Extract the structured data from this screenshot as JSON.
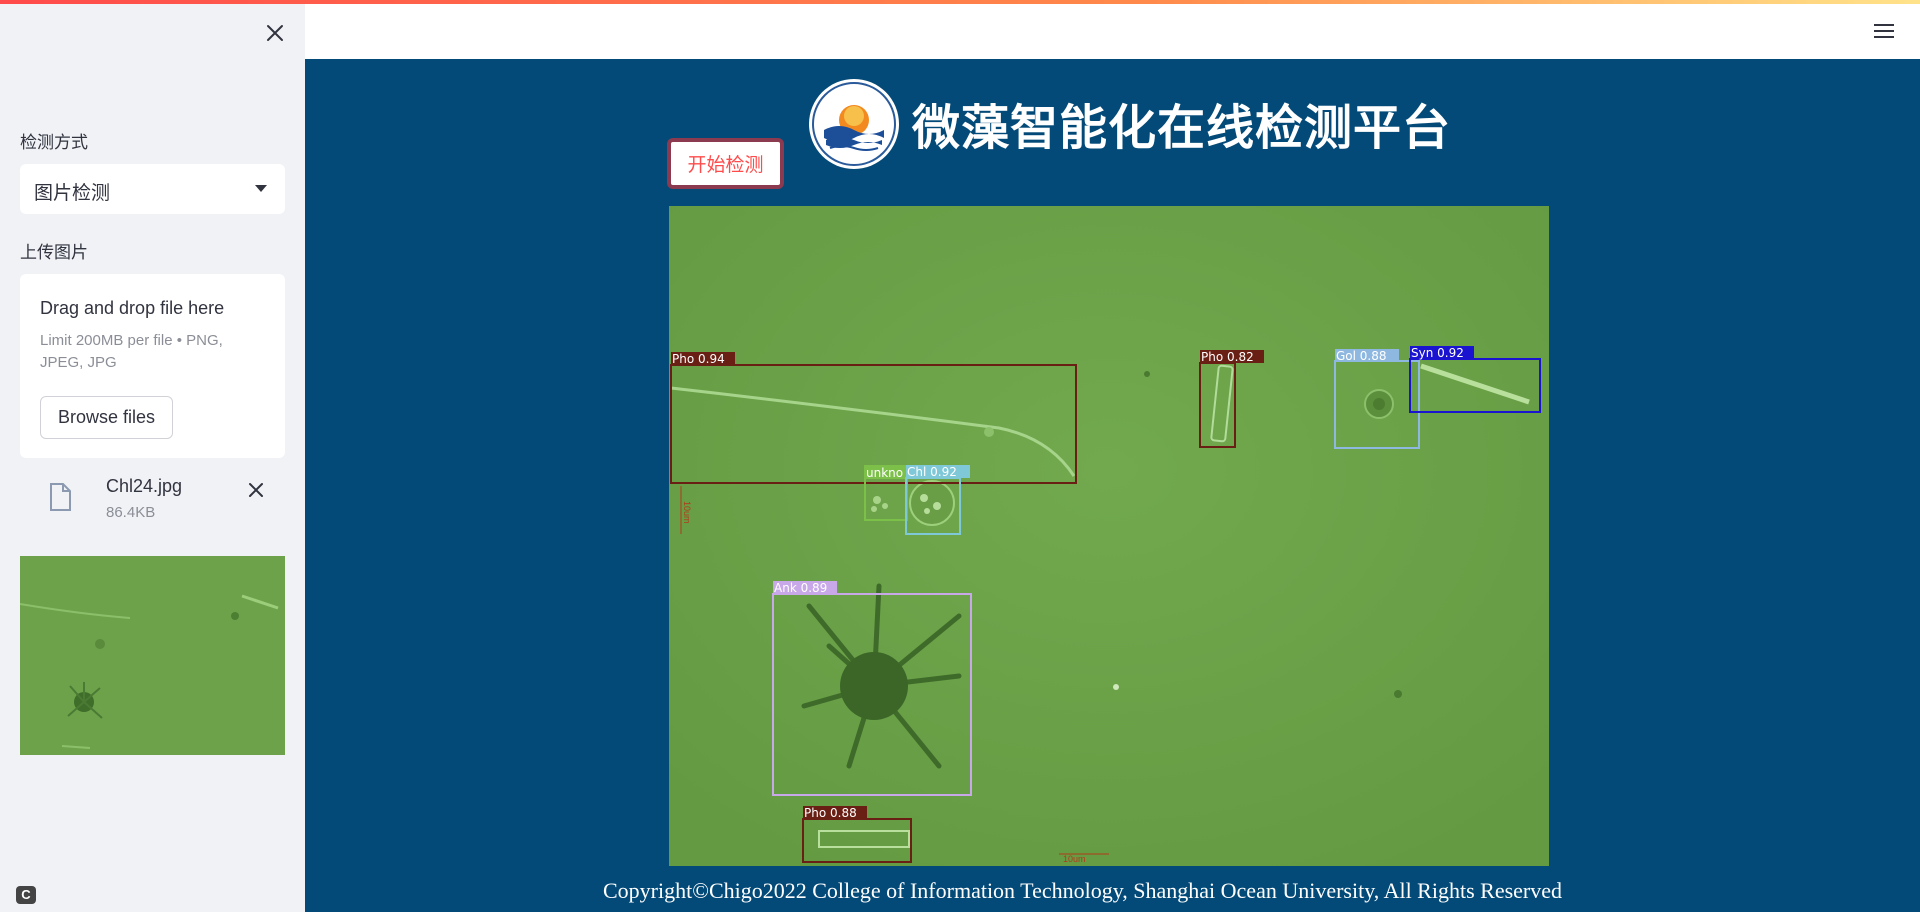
{
  "sidebar": {
    "detect_mode_label": "检测方式",
    "detect_mode_value": "图片检测",
    "upload_label": "上传图片",
    "dropzone_title": "Drag and drop file here",
    "dropzone_limit": "Limit 200MB per file • PNG, JPEG, JPG",
    "browse_label": "Browse files",
    "file_name": "Chl24.jpg",
    "file_size": "86.4KB"
  },
  "main": {
    "title": "微藻智能化在线检测平台",
    "start_button": "开始检测",
    "footer": "Copyright©Chigo2022 College of Information Technology, Shanghai Ocean University, All Rights Reserved"
  },
  "detections": [
    {
      "label": "Pho 0.94",
      "color": "#6a1f14"
    },
    {
      "label": "Pho 0.82",
      "color": "#6a1f14"
    },
    {
      "label": "Gol 0.88",
      "color": "#8fb8e0"
    },
    {
      "label": "Syn 0.92",
      "color": "#1a14d0"
    },
    {
      "label": "unkno",
      "color": "#7cc04a"
    },
    {
      "label": "Chl 0.92",
      "color": "#7fc8d8"
    },
    {
      "label": "Ank 0.89",
      "color": "#c8a8e8"
    },
    {
      "label": "Pho 0.88",
      "color": "#6a1f14"
    }
  ],
  "scale_bars": [
    "10um",
    "10um"
  ],
  "colors": {
    "sidebar_bg": "#f0f2f6",
    "main_bg": "#044a78",
    "accent": "#ff4b4b",
    "image_bg": "#6ea24a"
  }
}
